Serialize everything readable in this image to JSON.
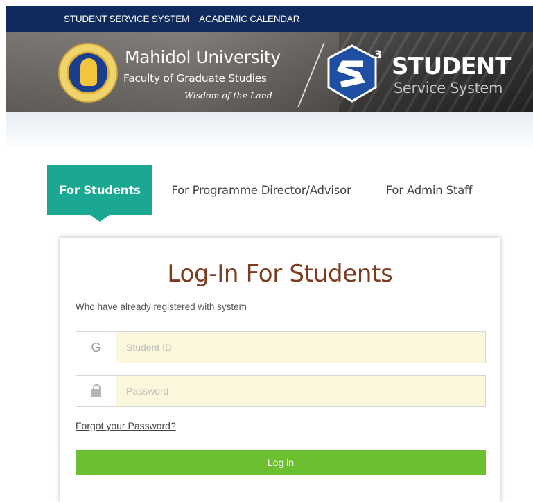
{
  "topnav": {
    "items": [
      {
        "label": "STUDENT SERVICE SYSTEM"
      },
      {
        "label": "ACADEMIC CALENDAR"
      }
    ]
  },
  "banner": {
    "university": "Mahidol University",
    "faculty": "Faculty of Graduate Studies",
    "motto": "Wisdom of the Land",
    "system_title": "STUDENT",
    "system_subtitle": "Service System",
    "s3_superscript": "3"
  },
  "tabs": [
    {
      "label": "For Students",
      "active": true
    },
    {
      "label": "For Programme Director/Advisor",
      "active": false
    },
    {
      "label": "For Admin Staff",
      "active": false
    }
  ],
  "login": {
    "title": "Log-In For Students",
    "subtitle": "Who have already registered with system",
    "student_id": {
      "prefix": "G",
      "placeholder": "Student ID",
      "value": ""
    },
    "password": {
      "icon": "lock-icon",
      "placeholder": "Password",
      "value": ""
    },
    "forgot_label": "Forgot your Password?",
    "submit_label": "Log in"
  },
  "colors": {
    "nav_bg": "#0f2a5c",
    "tab_active": "#1aa893",
    "title": "#7d3b1f",
    "input_bg": "#fbf7dd",
    "button": "#6cbf2e"
  }
}
